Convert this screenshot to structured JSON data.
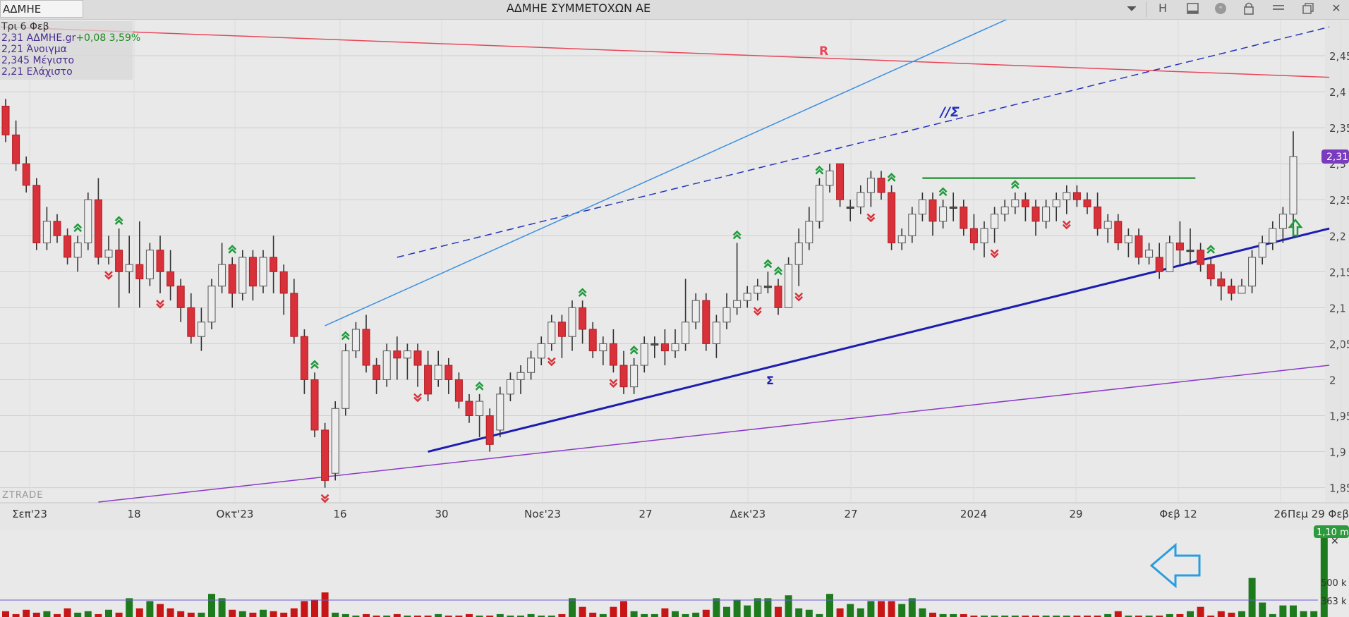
{
  "toolbar": {
    "symbol": "ΑΔΜΗΕ",
    "title": "ΑΔΜΗΕ ΣΥΜΜΕΤΟΧΩΝ ΑΕ",
    "dropdown_icon": "chevron-down-icon",
    "h_label": "H",
    "icons": [
      "panel-icon",
      "quote-icon",
      "lock-icon",
      "menu-icon",
      "restore-window-icon",
      "close-icon"
    ],
    "close_label": "✕"
  },
  "info_panel": {
    "date": "Τρι 6 Φεβ",
    "last": "2,31 ΑΔΜΗΕ.gr",
    "change": "+0,08 3,59%",
    "open": "2,21 Άνοιγμα",
    "high": "2,345 Μέγιστο",
    "low": "2,21 Ελάχιστο"
  },
  "watermark": "ZTRADE",
  "chart_data": [
    {
      "type": "candlestick",
      "x_labels": [
        "Σεπ'23",
        "18",
        "Οκτ'23",
        "16",
        "30",
        "Νοε'23",
        "27",
        "Δεκ'23",
        "27",
        "2024",
        "29",
        "Φεβ 12",
        "26",
        "Πεμ 29 Φεβ"
      ],
      "y_ticks": [
        "2,45",
        "2,4",
        "2,35",
        "2,3",
        "2,25",
        "2,2",
        "2,15",
        "2,1",
        "2,05",
        "2",
        "1,95",
        "1,9",
        "1,85"
      ],
      "ylim": [
        1.83,
        2.5
      ],
      "last_price_label": "2,31",
      "colors": {
        "up": "#ededed",
        "down": "#d8313a",
        "neutral": "#555555",
        "grid": "#cfcfcf"
      },
      "candles": [
        [
          2.38,
          2.34,
          2.39,
          2.33
        ],
        [
          2.34,
          2.3,
          2.36,
          2.29
        ],
        [
          2.3,
          2.27,
          2.31,
          2.26
        ],
        [
          2.27,
          2.19,
          2.28,
          2.18
        ],
        [
          2.19,
          2.22,
          2.24,
          2.18
        ],
        [
          2.22,
          2.2,
          2.23,
          2.19
        ],
        [
          2.2,
          2.17,
          2.21,
          2.16
        ],
        [
          2.17,
          2.19,
          2.2,
          2.15
        ],
        [
          2.19,
          2.25,
          2.26,
          2.18
        ],
        [
          2.25,
          2.17,
          2.28,
          2.16
        ],
        [
          2.17,
          2.18,
          2.2,
          2.16
        ],
        [
          2.18,
          2.15,
          2.21,
          2.1
        ],
        [
          2.15,
          2.16,
          2.2,
          2.12
        ],
        [
          2.16,
          2.14,
          2.22,
          2.1
        ],
        [
          2.14,
          2.18,
          2.19,
          2.13
        ],
        [
          2.18,
          2.15,
          2.2,
          2.12
        ],
        [
          2.15,
          2.13,
          2.18,
          2.11
        ],
        [
          2.13,
          2.1,
          2.14,
          2.08
        ],
        [
          2.1,
          2.06,
          2.12,
          2.05
        ],
        [
          2.06,
          2.08,
          2.1,
          2.04
        ],
        [
          2.08,
          2.13,
          2.14,
          2.07
        ],
        [
          2.13,
          2.16,
          2.19,
          2.12
        ],
        [
          2.16,
          2.12,
          2.17,
          2.1
        ],
        [
          2.12,
          2.17,
          2.18,
          2.11
        ],
        [
          2.17,
          2.13,
          2.18,
          2.11
        ],
        [
          2.13,
          2.17,
          2.18,
          2.12
        ],
        [
          2.17,
          2.15,
          2.2,
          2.12
        ],
        [
          2.15,
          2.12,
          2.16,
          2.09
        ],
        [
          2.12,
          2.06,
          2.14,
          2.05
        ],
        [
          2.06,
          2.0,
          2.07,
          1.98
        ],
        [
          2.0,
          1.93,
          2.01,
          1.92
        ],
        [
          1.93,
          1.86,
          1.94,
          1.85
        ],
        [
          1.87,
          1.96,
          1.97,
          1.86
        ],
        [
          1.96,
          2.04,
          2.05,
          1.95
        ],
        [
          2.04,
          2.07,
          2.08,
          2.03
        ],
        [
          2.07,
          2.02,
          2.09,
          2.01
        ],
        [
          2.02,
          2.0,
          2.03,
          1.98
        ],
        [
          2.0,
          2.04,
          2.05,
          1.99
        ],
        [
          2.04,
          2.03,
          2.06,
          2.0
        ],
        [
          2.03,
          2.04,
          2.05,
          2.0
        ],
        [
          2.04,
          2.02,
          2.05,
          1.99
        ],
        [
          2.02,
          1.98,
          2.04,
          1.97
        ],
        [
          2.0,
          2.02,
          2.04,
          1.99
        ],
        [
          2.02,
          2.0,
          2.03,
          1.98
        ],
        [
          2.0,
          1.97,
          2.01,
          1.96
        ],
        [
          1.97,
          1.95,
          1.98,
          1.94
        ],
        [
          1.95,
          1.97,
          1.98,
          1.92
        ],
        [
          1.95,
          1.91,
          1.96,
          1.9
        ],
        [
          1.93,
          1.98,
          1.99,
          1.92
        ],
        [
          1.98,
          2.0,
          2.01,
          1.97
        ],
        [
          2.0,
          2.01,
          2.02,
          1.98
        ],
        [
          2.01,
          2.03,
          2.04,
          2.0
        ],
        [
          2.03,
          2.05,
          2.06,
          2.02
        ],
        [
          2.05,
          2.08,
          2.09,
          2.04
        ],
        [
          2.08,
          2.06,
          2.09,
          2.03
        ],
        [
          2.06,
          2.1,
          2.11,
          2.04
        ],
        [
          2.1,
          2.07,
          2.11,
          2.05
        ],
        [
          2.07,
          2.04,
          2.08,
          2.03
        ],
        [
          2.04,
          2.05,
          2.06,
          2.02
        ],
        [
          2.05,
          2.02,
          2.07,
          2.01
        ],
        [
          2.02,
          1.99,
          2.04,
          1.98
        ],
        [
          1.99,
          2.02,
          2.03,
          1.98
        ],
        [
          2.02,
          2.05,
          2.06,
          2.01
        ],
        [
          2.05,
          2.05,
          2.06,
          2.03
        ],
        [
          2.05,
          2.04,
          2.07,
          2.02
        ],
        [
          2.04,
          2.05,
          2.07,
          2.03
        ],
        [
          2.05,
          2.08,
          2.14,
          2.04
        ],
        [
          2.08,
          2.11,
          2.12,
          2.07
        ],
        [
          2.11,
          2.05,
          2.12,
          2.04
        ],
        [
          2.05,
          2.08,
          2.09,
          2.03
        ],
        [
          2.08,
          2.1,
          2.12,
          2.07
        ],
        [
          2.1,
          2.11,
          2.19,
          2.09
        ],
        [
          2.11,
          2.12,
          2.13,
          2.1
        ],
        [
          2.12,
          2.13,
          2.14,
          2.11
        ],
        [
          2.13,
          2.13,
          2.15,
          2.12
        ],
        [
          2.13,
          2.1,
          2.14,
          2.09
        ],
        [
          2.1,
          2.16,
          2.17,
          2.1
        ],
        [
          2.16,
          2.19,
          2.21,
          2.13
        ],
        [
          2.19,
          2.22,
          2.24,
          2.18
        ],
        [
          2.22,
          2.27,
          2.28,
          2.21
        ],
        [
          2.27,
          2.29,
          2.3,
          2.26
        ],
        [
          2.3,
          2.25,
          2.3,
          2.24
        ],
        [
          2.24,
          2.24,
          2.25,
          2.22
        ],
        [
          2.24,
          2.26,
          2.27,
          2.23
        ],
        [
          2.26,
          2.28,
          2.29,
          2.24
        ],
        [
          2.28,
          2.26,
          2.29,
          2.25
        ],
        [
          2.26,
          2.19,
          2.27,
          2.18
        ],
        [
          2.19,
          2.2,
          2.21,
          2.18
        ],
        [
          2.2,
          2.23,
          2.24,
          2.19
        ],
        [
          2.23,
          2.25,
          2.26,
          2.22
        ],
        [
          2.25,
          2.22,
          2.26,
          2.2
        ],
        [
          2.22,
          2.24,
          2.25,
          2.21
        ],
        [
          2.24,
          2.24,
          2.26,
          2.22
        ],
        [
          2.24,
          2.21,
          2.25,
          2.2
        ],
        [
          2.21,
          2.19,
          2.23,
          2.18
        ],
        [
          2.19,
          2.21,
          2.22,
          2.17
        ],
        [
          2.21,
          2.23,
          2.24,
          2.19
        ],
        [
          2.23,
          2.24,
          2.25,
          2.22
        ],
        [
          2.24,
          2.25,
          2.26,
          2.23
        ],
        [
          2.25,
          2.24,
          2.26,
          2.22
        ],
        [
          2.24,
          2.22,
          2.25,
          2.2
        ],
        [
          2.22,
          2.24,
          2.25,
          2.21
        ],
        [
          2.24,
          2.25,
          2.26,
          2.22
        ],
        [
          2.25,
          2.26,
          2.27,
          2.23
        ],
        [
          2.26,
          2.25,
          2.27,
          2.24
        ],
        [
          2.25,
          2.24,
          2.26,
          2.23
        ],
        [
          2.24,
          2.21,
          2.26,
          2.2
        ],
        [
          2.21,
          2.22,
          2.23,
          2.19
        ],
        [
          2.22,
          2.19,
          2.23,
          2.18
        ],
        [
          2.19,
          2.2,
          2.21,
          2.17
        ],
        [
          2.2,
          2.17,
          2.21,
          2.16
        ],
        [
          2.17,
          2.18,
          2.19,
          2.16
        ],
        [
          2.17,
          2.15,
          2.19,
          2.14
        ],
        [
          2.15,
          2.19,
          2.2,
          2.15
        ],
        [
          2.19,
          2.18,
          2.22,
          2.16
        ],
        [
          2.18,
          2.18,
          2.21,
          2.16
        ],
        [
          2.18,
          2.16,
          2.19,
          2.15
        ],
        [
          2.16,
          2.14,
          2.17,
          2.13
        ],
        [
          2.14,
          2.13,
          2.15,
          2.11
        ],
        [
          2.13,
          2.12,
          2.14,
          2.11
        ],
        [
          2.12,
          2.13,
          2.14,
          2.12
        ],
        [
          2.13,
          2.17,
          2.18,
          2.12
        ],
        [
          2.17,
          2.19,
          2.2,
          2.16
        ],
        [
          2.19,
          2.21,
          2.22,
          2.18
        ],
        [
          2.21,
          2.23,
          2.24,
          2.19
        ],
        [
          2.23,
          2.31,
          2.345,
          2.21
        ]
      ],
      "trend_lines": [
        {
          "label": "R",
          "color": "#e8475a",
          "from": [
            -0.5,
            2.49
          ],
          "to": [
            128.5,
            2.42
          ]
        },
        {
          "label": "//Σ",
          "color": "#2233bb",
          "dashed": true,
          "from": [
            38.0,
            2.17
          ],
          "to": [
            128.5,
            2.49
          ]
        },
        {
          "label": "Σ",
          "color": "#1d1db0",
          "from": [
            41.0,
            1.9
          ],
          "to": [
            128.5,
            2.21
          ]
        },
        {
          "label": "",
          "color": "#3b8fe0",
          "from": [
            31.0,
            2.075
          ],
          "to": [
            108.0,
            2.57
          ]
        },
        {
          "label": "",
          "color": "#8a3ac8",
          "from": [
            9.0,
            1.83
          ],
          "to": [
            128.5,
            2.02
          ]
        },
        {
          "label": "",
          "color": "#2e9a3e",
          "from": [
            89.0,
            2.28
          ],
          "to": [
            115.5,
            2.28
          ]
        }
      ],
      "up_signal_indices": [
        7,
        11,
        22,
        30,
        33,
        46,
        56,
        61,
        71,
        74,
        75,
        79,
        86,
        91,
        98,
        117
      ],
      "down_signal_indices": [
        10,
        15,
        31,
        40,
        53,
        59,
        73,
        77,
        84,
        96,
        103
      ],
      "volume": {
        "values": [
          40,
          20,
          50,
          30,
          40,
          20,
          60,
          30,
          40,
          20,
          50,
          30,
          130,
          60,
          110,
          90,
          60,
          40,
          30,
          30,
          160,
          130,
          50,
          40,
          30,
          50,
          40,
          30,
          60,
          110,
          120,
          170,
          30,
          20,
          10,
          20,
          10,
          10,
          20,
          10,
          10,
          10,
          20,
          10,
          10,
          20,
          10,
          10,
          20,
          10,
          10,
          20,
          10,
          10,
          20,
          130,
          70,
          30,
          20,
          70,
          110,
          40,
          20,
          20,
          60,
          40,
          20,
          30,
          50,
          130,
          70,
          120,
          80,
          130,
          130,
          70,
          150,
          60,
          50,
          20,
          160,
          60,
          90,
          60,
          110,
          110,
          110,
          90,
          130,
          60,
          30,
          20,
          20,
          20,
          10,
          10,
          10,
          10,
          10,
          10,
          10,
          10,
          10,
          10,
          10,
          10,
          10,
          20,
          40,
          10,
          10,
          10,
          10,
          20,
          20,
          40,
          70,
          10,
          40,
          30,
          40,
          270,
          100,
          20,
          80,
          80,
          40,
          40,
          560
        ],
        "up_colors": "#1d7a1d",
        "down_colors": "#c81515",
        "avg_line_label": "363 k",
        "tick_label": "500 k",
        "last_label": "1,10 m"
      }
    }
  ]
}
